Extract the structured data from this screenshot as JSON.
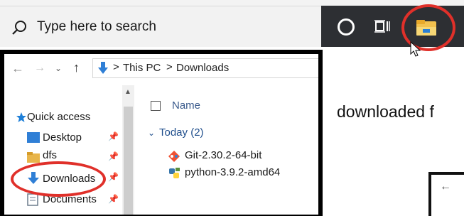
{
  "taskbar": {
    "search_placeholder": "Type here to search"
  },
  "explorer": {
    "breadcrumb": [
      "This PC",
      "Downloads"
    ],
    "breadcrumb_sep": ">",
    "sidebar": [
      {
        "label": "Quick access",
        "icon": "star-icon",
        "pinned": false
      },
      {
        "label": "Desktop",
        "icon": "desktop-folder-icon",
        "pinned": true
      },
      {
        "label": "dfs",
        "icon": "folder-icon",
        "pinned": true
      },
      {
        "label": "Downloads",
        "icon": "download-folder-icon",
        "pinned": true
      },
      {
        "label": "Documents",
        "icon": "documents-icon",
        "pinned": true
      }
    ],
    "column_name": "Name",
    "group_label": "Today (2)",
    "files": [
      {
        "name": "Git-2.30.2-64-bit",
        "icon": "git-installer-icon"
      },
      {
        "name": "python-3.9.2-amd64",
        "icon": "python-installer-icon"
      }
    ]
  },
  "side_text": "downloaded f",
  "colors": {
    "highlight_ring": "#e0302a",
    "taskbar_dark": "#2d2f33",
    "quick_access_blue": "#1e7fd8"
  }
}
